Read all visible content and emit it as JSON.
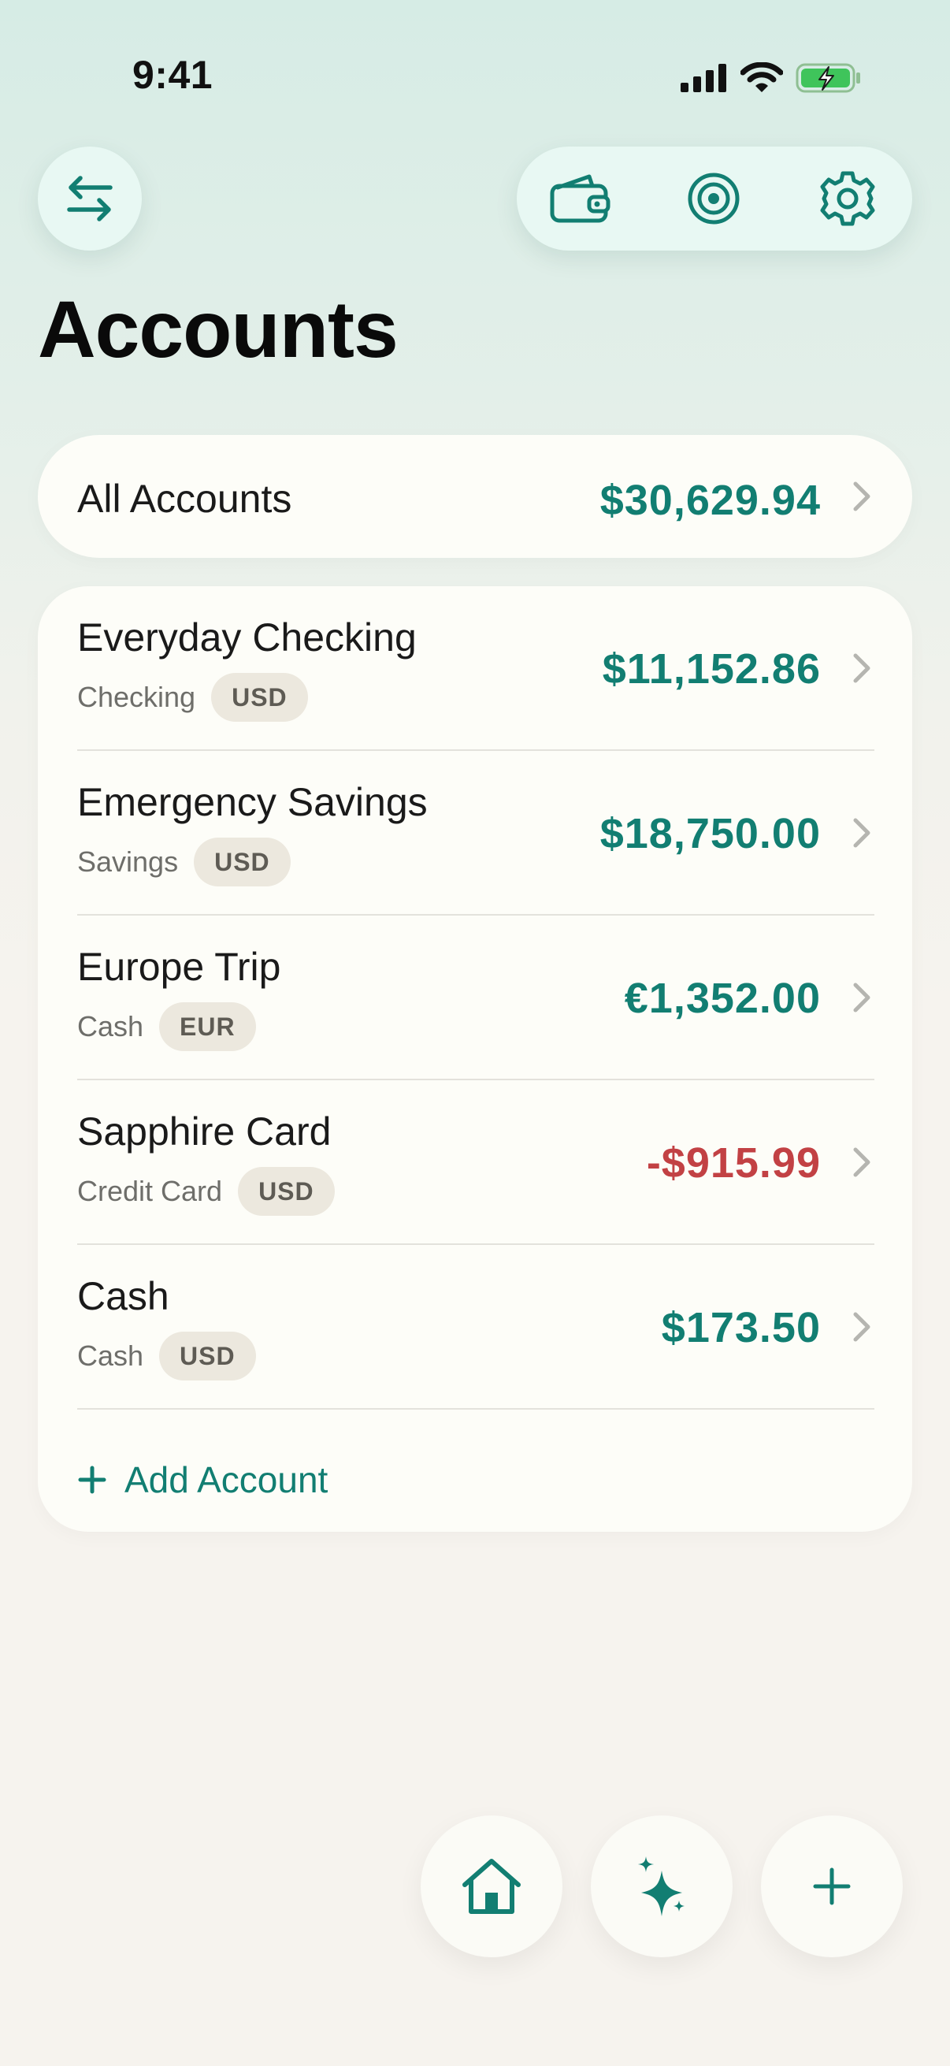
{
  "status_bar": {
    "time": "9:41"
  },
  "colors": {
    "accent": "#127e72",
    "negative": "#c24144",
    "card": "#fdfdf8",
    "toolbar": "#e8f8f3"
  },
  "header": {
    "transfer_icon": "arrows-left-right-icon",
    "toolbar_icons": [
      "wallet-icon",
      "target-icon",
      "gear-icon"
    ]
  },
  "page": {
    "title": "Accounts"
  },
  "all_accounts": {
    "label": "All Accounts",
    "amount": "$30,629.94"
  },
  "accounts": [
    {
      "name": "Everyday Checking",
      "type": "Checking",
      "currency": "USD",
      "balance": "$11,152.86",
      "negative": false
    },
    {
      "name": "Emergency Savings",
      "type": "Savings",
      "currency": "USD",
      "balance": "$18,750.00",
      "negative": false
    },
    {
      "name": "Europe Trip",
      "type": "Cash",
      "currency": "EUR",
      "balance": "€1,352.00",
      "negative": false
    },
    {
      "name": "Sapphire Card",
      "type": "Credit Card",
      "currency": "USD",
      "balance": "-$915.99",
      "negative": true
    },
    {
      "name": "Cash",
      "type": "Cash",
      "currency": "USD",
      "balance": "$173.50",
      "negative": false
    }
  ],
  "add_account": {
    "label": "Add Account"
  },
  "bottom_bar": {
    "icons": [
      "home-icon",
      "sparkle-icon",
      "plus-icon"
    ]
  }
}
